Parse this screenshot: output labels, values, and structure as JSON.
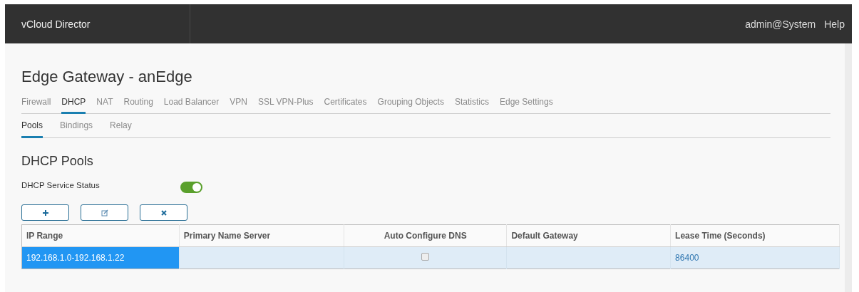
{
  "header": {
    "product": "vCloud Director",
    "user": "admin@System",
    "help": "Help"
  },
  "page_title": "Edge Gateway - anEdge",
  "tabs": [
    {
      "label": "Firewall",
      "selected": false
    },
    {
      "label": "DHCP",
      "selected": true
    },
    {
      "label": "NAT",
      "selected": false
    },
    {
      "label": "Routing",
      "selected": false
    },
    {
      "label": "Load Balancer",
      "selected": false
    },
    {
      "label": "VPN",
      "selected": false
    },
    {
      "label": "SSL VPN-Plus",
      "selected": false
    },
    {
      "label": "Certificates",
      "selected": false
    },
    {
      "label": "Grouping Objects",
      "selected": false
    },
    {
      "label": "Statistics",
      "selected": false
    },
    {
      "label": "Edge Settings",
      "selected": false
    }
  ],
  "subtabs": [
    {
      "label": "Pools",
      "selected": true
    },
    {
      "label": "Bindings",
      "selected": false
    },
    {
      "label": "Relay",
      "selected": false
    }
  ],
  "section_title": "DHCP Pools",
  "service_status": {
    "label": "DHCP Service Status",
    "on": true
  },
  "toolbar": [
    {
      "kind": "add"
    },
    {
      "kind": "edit"
    },
    {
      "kind": "delete"
    }
  ],
  "table": {
    "columns": [
      "IP Range",
      "Primary Name Server",
      "Auto Configure DNS",
      "Default Gateway",
      "Lease Time (Seconds)"
    ],
    "rows": [
      {
        "selected": true,
        "ip_range": "192.168.1.0-192.168.1.22",
        "auto_configure_dns": false,
        "lease_time": "86400"
      }
    ]
  }
}
